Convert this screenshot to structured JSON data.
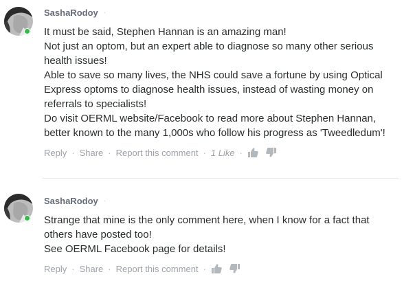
{
  "comments": [
    {
      "author": "SashaRodoy",
      "separator": "·",
      "lines": [
        "It must be said, Stephen Hannan is an amazing man!",
        "Not just an optom, but an expert able to diagnose so many other serious health issues!",
        "Able to save so many lives, the NHS could save a fortune by using Optical Express optoms to diagnose health issues, instead of wasting money on referrals to specialists!",
        "Do visit OERML website/Facebook to read more about Stephen Hannan, better known to the many 1,000s who follow his progress as 'Tweedledum'!"
      ],
      "actions": {
        "reply": "Reply",
        "share": "Share",
        "report": "Report this comment",
        "likes": "1 Like"
      }
    },
    {
      "author": "SashaRodoy",
      "separator": "·",
      "lines": [
        "Strange that mine is the only comment here, when I know for a fact that others have posted too!",
        "See OERML Facebook page for details!"
      ],
      "actions": {
        "reply": "Reply",
        "share": "Share",
        "report": "Report this comment",
        "likes": ""
      }
    }
  ],
  "footer_separator": "·",
  "icons": {
    "upvote": "thumbs-up-icon",
    "downvote": "thumbs-down-icon",
    "online": "online-status-dot"
  },
  "colors": {
    "author": "#656c7a",
    "text": "#2a2e2e",
    "muted": "#9da2a8",
    "online": "#3cb54a",
    "vote_icon": "#b3b8bd"
  }
}
